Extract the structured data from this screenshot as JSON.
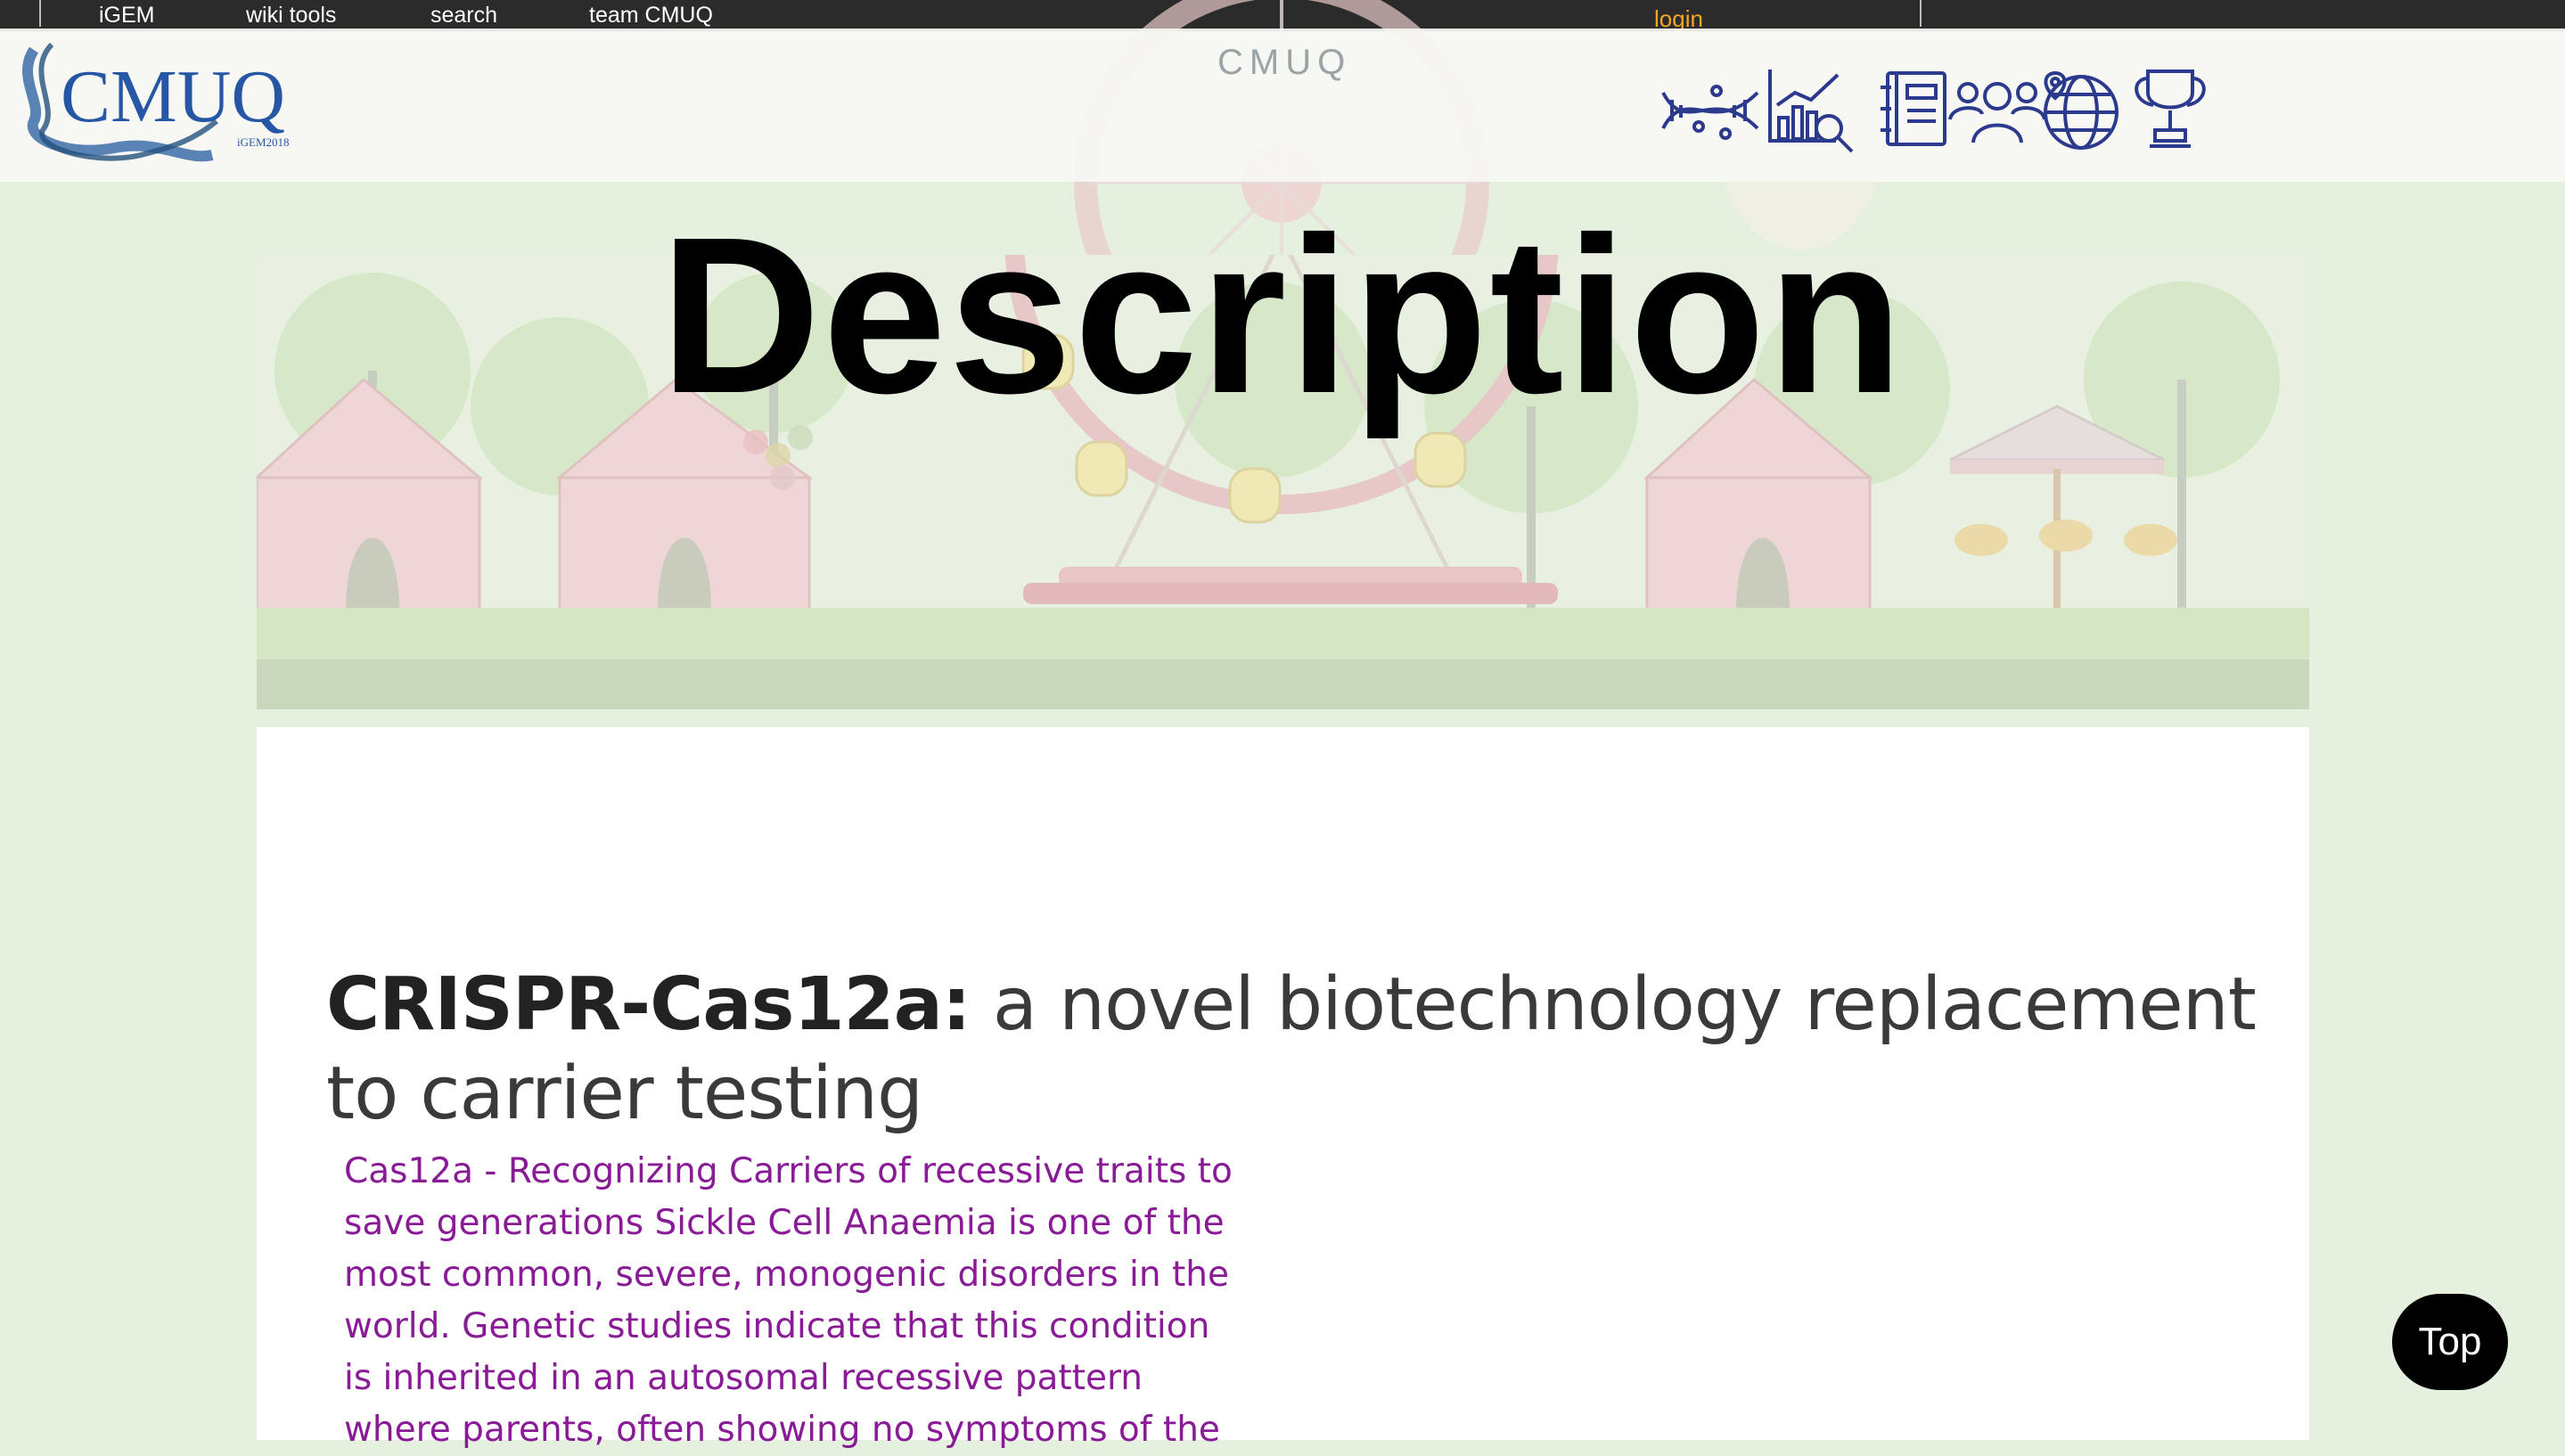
{
  "topbar": {
    "items": [
      "iGEM",
      "wiki tools",
      "search",
      "team CMUQ"
    ],
    "login_label": "login"
  },
  "header": {
    "logo_text": "CMUQ",
    "logo_subtext": "iGEM2018",
    "site_title": "CMUQ",
    "nav_icons": [
      "dna-icon",
      "analytics-icon",
      "notebook-icon",
      "team-icon",
      "globe-icon",
      "trophy-icon"
    ]
  },
  "hero": {
    "title": "Description"
  },
  "content": {
    "heading_bold": "CRISPR-Cas12a:",
    "heading_light": " a novel biotechnology replacement to carrier testing",
    "intro": "Cas12a - Recognizing Carriers of recessive traits to save generations Sickle Cell Anaemia is one of the most common, severe, monogenic disorders in the world. Genetic studies indicate that this condition is inherited in an autosomal recessive pattern where parents, often showing no symptoms of the"
  },
  "top_button_label": "Top",
  "colors": {
    "topbar": "#2b2b2b",
    "login": "#f5a623",
    "icon_stroke": "#2b3a8c",
    "page_bg": "#e6f0df",
    "intro_text": "#8a1b96"
  }
}
